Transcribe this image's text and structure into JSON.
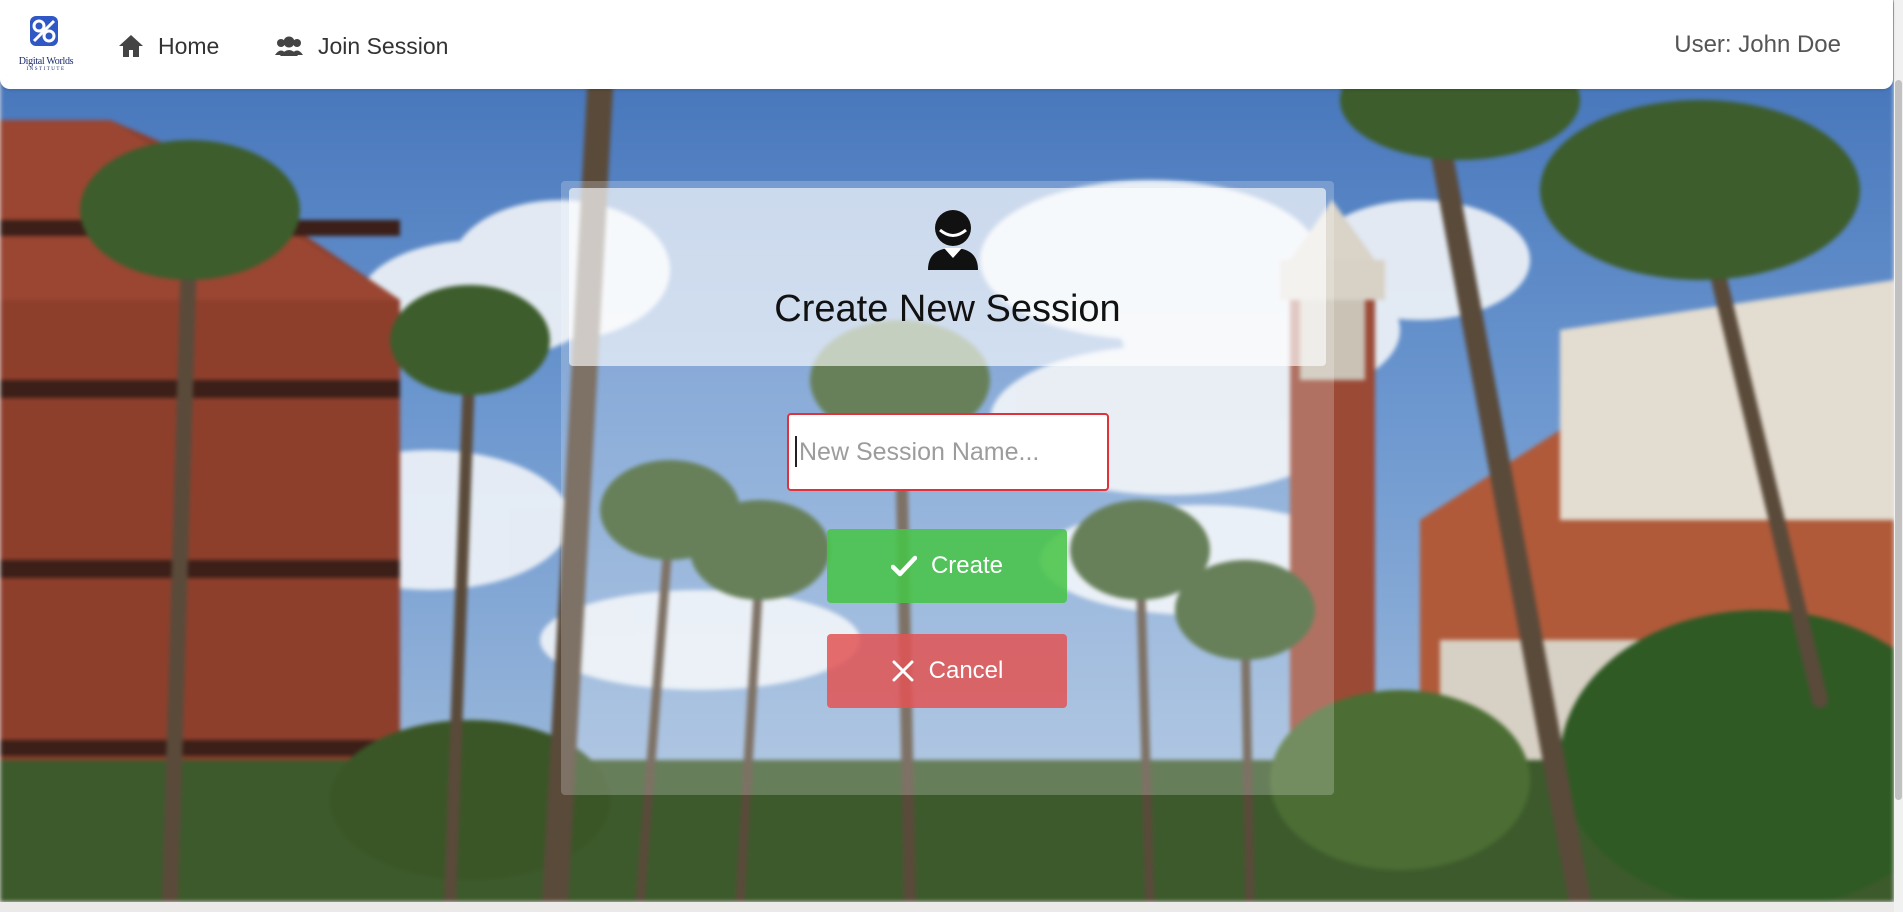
{
  "colors": {
    "navbar_bg": "#ffffff",
    "create_button": "#48c448",
    "cancel_button": "#e25454",
    "input_border": "#e0323a",
    "logo_blue": "#1a2a6b"
  },
  "logo": {
    "name": "Digital Worlds",
    "sub": "INSTITUTE"
  },
  "navbar": {
    "home_label": "Home",
    "home_icon": "home-icon",
    "join_label": "Join Session",
    "join_icon": "users-icon",
    "user_label": "User: John Doe"
  },
  "panel": {
    "icon": "person-icon",
    "title": "Create New Session",
    "input_placeholder": "New Session Name...",
    "input_value": "",
    "create_label": "Create",
    "create_icon": "check-icon",
    "cancel_label": "Cancel",
    "cancel_icon": "close-icon"
  }
}
